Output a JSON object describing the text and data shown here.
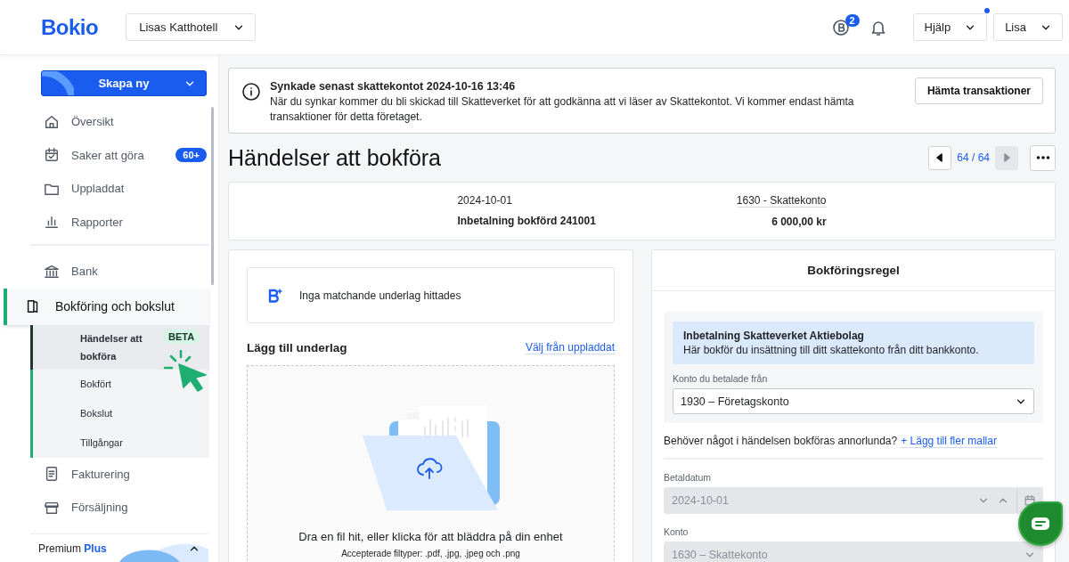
{
  "header": {
    "logo": "Bokio",
    "company": "Lisas Katthotell",
    "coins_badge": "2",
    "help": {
      "label": "Hjälp",
      "notification": true
    },
    "user": "Lisa"
  },
  "sidebar": {
    "create_button": "Skapa ny",
    "items": [
      {
        "label": "Översikt"
      },
      {
        "label": "Saker att göra",
        "badge": "60+"
      },
      {
        "label": "Uppladdat"
      },
      {
        "label": "Rapporter"
      }
    ],
    "items_2": [
      {
        "label": "Bank"
      },
      {
        "label": "Bokföring och bokslut",
        "expanded": true,
        "children": [
          {
            "label": "Händelser att bokföra",
            "selected": true,
            "badge": "BETA"
          },
          {
            "label": "Bokfört",
            "selected": false
          },
          {
            "label": "Bokslut",
            "selected": false
          },
          {
            "label": "Tillgångar",
            "selected": false
          }
        ]
      },
      {
        "label": "Fakturering"
      },
      {
        "label": "Försäljning"
      }
    ],
    "plan": {
      "label": "Premium",
      "tier": "Plus"
    }
  },
  "sync_banner": {
    "title": "Synkade senast skattekontot 2024-10-16 13:46",
    "text": "När du synkar kommer du bli skickad till Skatteverket för att godkänna att vi läser av Skattekontot. Vi kommer endast hämta transaktioner för detta företaget.",
    "button": "Hämta transaktioner"
  },
  "page_title": "Händelser att bokföra",
  "pager": {
    "label": "64 / 64",
    "prev_disabled": false,
    "next_disabled": true
  },
  "summary": {
    "date": "2024-10-01",
    "description": "Inbetalning bokförd 241001",
    "account": "1630 - Skattekonto",
    "amount": "6 000,00 kr"
  },
  "match": {
    "text": "Inga matchande underlag hittades"
  },
  "attachments": {
    "title": "Lägg till underlag",
    "link": "Välj från uppladdat",
    "drop_text": "Dra en fil hit, eller klicka för att bläddra på din enhet",
    "file_types": "Accepterade filtyper: .pdf, .jpg, .jpeg och .png"
  },
  "rule": {
    "title": "Bokföringsregel",
    "template_title": "Inbetalning Skatteverket Aktiebolag",
    "template_text": "Här bokför du insättning till ditt skattekonto från ditt bankkonto.",
    "account_field": {
      "label": "Konto du betalade från",
      "value": "1930 – Företagskonto",
      "disabled": false
    },
    "question": "Behöver något i händelsen bokföras annorlunda?",
    "add_link": "+ Lägg till fler mallar",
    "fields": [
      {
        "kind": "date",
        "label": "Betaldatum",
        "value": "2024-10-01",
        "disabled": true
      },
      {
        "kind": "select",
        "label": "Konto",
        "value": "1630 – Skattekonto",
        "disabled": true
      }
    ]
  }
}
